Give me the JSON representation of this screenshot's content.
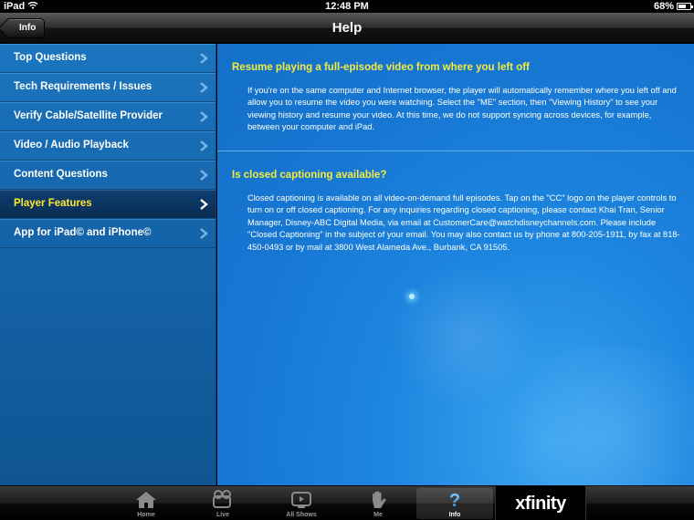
{
  "status": {
    "carrier": "iPad",
    "time": "12:48 PM",
    "battery_text": "68%",
    "battery_level": 0.68
  },
  "nav": {
    "back_label": "Info",
    "title": "Help"
  },
  "sidebar": {
    "items": [
      {
        "label": "Top Questions"
      },
      {
        "label": "Tech Requirements / Issues"
      },
      {
        "label": "Verify Cable/Satellite Provider"
      },
      {
        "label": "Video / Audio Playback"
      },
      {
        "label": "Content Questions"
      },
      {
        "label": "Player Features",
        "selected": true
      },
      {
        "label": "App for iPad© and iPhone©"
      }
    ]
  },
  "content": {
    "sections": [
      {
        "question": "Resume playing a full-episode video from where you left off",
        "answer": "If you're on the same computer and Internet browser, the player will automatically remember where you left off and allow you to resume the video you were watching.  Select the \"ME\" section, then \"Viewing History\" to see your viewing history and resume your video.  At this time, we do not support syncing across devices, for example, between your computer and iPad."
      },
      {
        "question": "Is closed captioning available?",
        "answer": "Closed captioning is available on all video-on-demand full episodes. Tap on the \"CC\" logo on the player controls to turn on or off closed captioning. For any inquiries regarding closed captioning, please contact Khai Tran, Senior Manager, Disney-ABC Digital Media, via email at CustomerCare@watchdisneychannels.com. Please include \"Closed Captioning\" in the subject of your email. You may also contact us by phone at 800-205-1911, by fax at 818-450-0493 or by mail at 3800 West Alameda Ave., Burbank, CA 91505."
      }
    ]
  },
  "tabbar": {
    "tabs": [
      {
        "label": "Home",
        "icon": "home-icon"
      },
      {
        "label": "Live",
        "icon": "live-icon"
      },
      {
        "label": "All Shows",
        "icon": "tv-icon"
      },
      {
        "label": "Me",
        "icon": "hand-icon"
      },
      {
        "label": "Info",
        "icon": "question-icon",
        "selected": true
      }
    ],
    "brand": "xfinity"
  },
  "colors": {
    "accent_yellow": "#f5ec3c",
    "content_blue": "#1676d2",
    "sidebar_blue": "#1565ab"
  }
}
